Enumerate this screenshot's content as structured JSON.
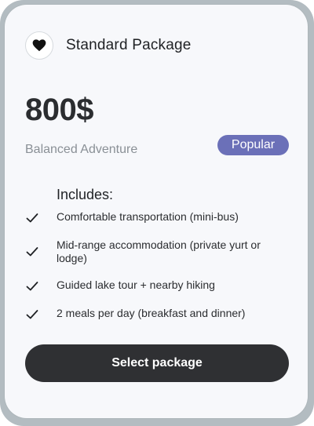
{
  "package": {
    "title": "Standard Package",
    "icon": "heart-icon",
    "price": "800$",
    "subtitle": "Balanced Adventure",
    "badge": "Popular",
    "includes_heading": "Includes:",
    "features": [
      "Comfortable transportation (mini-bus)",
      "Mid-range accommodation (private yurt or lodge)",
      "Guided lake tour + nearby hiking",
      "2 meals per day (breakfast and dinner)"
    ],
    "cta_label": "Select package"
  },
  "colors": {
    "badge_bg": "#6b70b8",
    "cta_bg": "#2f3033",
    "card_bg": "#f7f8fb",
    "frame_bg": "#b3bcc1"
  }
}
